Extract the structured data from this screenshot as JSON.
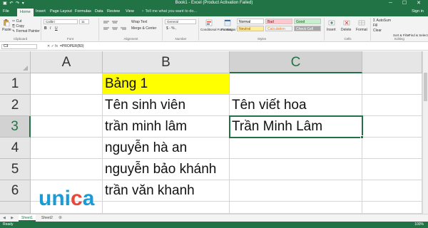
{
  "window": {
    "title": "Book1 - Excel (Product Activation Failed)",
    "qat": "▣ ↶ ↷ ▾",
    "controls": "─ ☐ ✕"
  },
  "ribbon_tabs": [
    {
      "label": "File",
      "active": false
    },
    {
      "label": "Home",
      "active": true
    },
    {
      "label": "Insert",
      "active": false
    },
    {
      "label": "Page Layout",
      "active": false
    },
    {
      "label": "Formulas",
      "active": false
    },
    {
      "label": "Data",
      "active": false
    },
    {
      "label": "Review",
      "active": false
    },
    {
      "label": "View",
      "active": false
    }
  ],
  "tell_me": "♀ Tell me what you want to do...",
  "sign_in": "Sign in",
  "ribbon": {
    "clipboard": {
      "paste": "Paste",
      "cut": "✂ Cut",
      "copy": "⎘ Copy",
      "format_painter": "✎ Format Painter",
      "label": "Clipboard"
    },
    "font": {
      "name": "Calibri",
      "size": "11",
      "label": "Font",
      "bold": "B",
      "italic": "I",
      "underline": "U"
    },
    "alignment": {
      "wrap": "Wrap Text",
      "merge": "Merge & Center",
      "label": "Alignment"
    },
    "number": {
      "format": "General",
      "symbols": "$ - % ,",
      "label": "Number"
    },
    "styles": {
      "conditional": "Conditional Formatting",
      "format_table": "Format as Table",
      "cells": [
        {
          "label": "Normal",
          "bg": "#ffffff",
          "fg": "#000000"
        },
        {
          "label": "Bad",
          "bg": "#ffc7ce",
          "fg": "#9c0006"
        },
        {
          "label": "Good",
          "bg": "#c6efce",
          "fg": "#006100"
        },
        {
          "label": "Neutral",
          "bg": "#ffeb9c",
          "fg": "#9c5700"
        },
        {
          "label": "Calculation",
          "bg": "#f2f2f2",
          "fg": "#fa7d00"
        },
        {
          "label": "Check Cell",
          "bg": "#a5a5a5",
          "fg": "#ffffff"
        }
      ],
      "label": "Styles"
    },
    "cells": {
      "insert": "Insert",
      "delete": "Delete",
      "format": "Format",
      "label": "Cells"
    },
    "editing": {
      "autosum": "Σ AutoSum",
      "fill": "Fill",
      "clear": "Clear",
      "sort": "Sort & Filter",
      "find": "Find & Select",
      "label": "Editing"
    }
  },
  "formula_bar": {
    "name_box": "C3",
    "fx": "✕ ✓ fx",
    "formula": "=PROPER(B3)"
  },
  "columns": [
    "A",
    "B",
    "C"
  ],
  "selected_column": "C",
  "rows": [
    {
      "n": "1",
      "A": "",
      "B": "Bảng 1",
      "C": ""
    },
    {
      "n": "2",
      "A": "",
      "B": "Tên sinh viên",
      "C": "Tên viết hoa"
    },
    {
      "n": "3",
      "A": "",
      "B": "trần minh lâm",
      "C": "Trần Minh Lâm"
    },
    {
      "n": "4",
      "A": "",
      "B": "nguyễn hà an",
      "C": ""
    },
    {
      "n": "5",
      "A": "",
      "B": "nguyễn bảo khánh",
      "C": ""
    },
    {
      "n": "6",
      "A": "",
      "B": "trần văn khanh",
      "C": ""
    }
  ],
  "highlight": {
    "cell": "B1",
    "color": "#ffff00"
  },
  "accent_color": "#217346",
  "sheets": [
    "Sheet1",
    "Sheet2"
  ],
  "active_sheet": "Sheet1",
  "status": {
    "ready": "Ready",
    "zoom": "100%"
  },
  "watermark": {
    "text": "unica",
    "letter_colors": [
      "#1a9bd7",
      "#1a9bd7",
      "#1a9bd7",
      "#e8473a",
      "#1a9bd7"
    ]
  }
}
